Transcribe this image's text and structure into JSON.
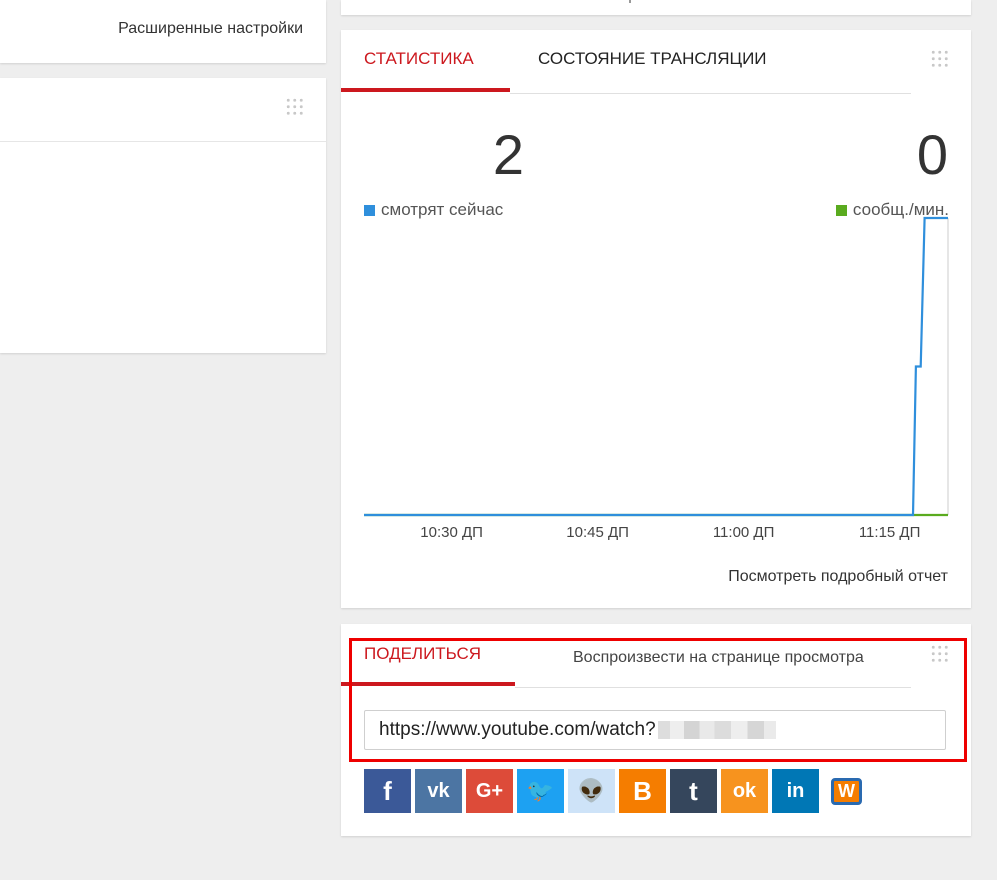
{
  "left_panel": {
    "advanced_settings_label": "Расширенные настройки"
  },
  "stats": {
    "tabs": [
      {
        "label": "СТАТИСТИКА",
        "active": true
      },
      {
        "label": "СОСТОЯНИЕ ТРАНСЛЯЦИИ",
        "active": false
      }
    ],
    "viewers_now": "2",
    "viewers_label": "смотрят сейчас",
    "messages_per_min": "0",
    "messages_label": "сообщ./мин.",
    "report_link": "Посмотреть подробный отчет",
    "colors": {
      "viewers": "#2f8fdc",
      "messages": "#5aab1f",
      "accent": "#cc181e"
    }
  },
  "chart_data": {
    "type": "line",
    "x_tick_labels": [
      "10:30 ДП",
      "10:45 ДП",
      "11:00 ДП",
      "11:15 ДП"
    ],
    "x_ticks_minutes": [
      630,
      645,
      660,
      675
    ],
    "xlim_minutes": [
      621,
      681
    ],
    "ylim": [
      0,
      2
    ],
    "series": [
      {
        "name": "смотрят сейчас",
        "color": "#2f8fdc",
        "points": [
          [
            621,
            0
          ],
          [
            677.4,
            0
          ],
          [
            677.7,
            1
          ],
          [
            678.2,
            1
          ],
          [
            678.6,
            2
          ],
          [
            681,
            2
          ]
        ]
      },
      {
        "name": "сообщ./мин.",
        "color": "#5aab1f",
        "points": [
          [
            621,
            0
          ],
          [
            681,
            0
          ]
        ]
      }
    ],
    "grid": false,
    "legend": "top"
  },
  "share": {
    "tab_share": "ПОДЕЛИТЬСЯ",
    "tab_play": "Воспроизвести на странице просмотра",
    "url_visible": "https://www.youtube.com/watch?",
    "social": [
      {
        "icon": "facebook-icon",
        "glyph": "f",
        "color": "#3b5998"
      },
      {
        "icon": "vk-icon",
        "glyph": "vk",
        "color": "#4c75a3"
      },
      {
        "icon": "google-plus-icon",
        "glyph": "G+",
        "color": "#dd4b39"
      },
      {
        "icon": "twitter-icon",
        "glyph": "🐦",
        "color": "#1da1f2"
      },
      {
        "icon": "reddit-icon",
        "glyph": "👽",
        "color": "#cee3f8"
      },
      {
        "icon": "blogger-icon",
        "glyph": "B",
        "color": "#f57d00"
      },
      {
        "icon": "tumblr-icon",
        "glyph": "t",
        "color": "#35465c"
      },
      {
        "icon": "odnoklassniki-icon",
        "glyph": "ok",
        "color": "#f7931e"
      },
      {
        "icon": "linkedin-icon",
        "glyph": "in",
        "color": "#0077b5"
      },
      {
        "icon": "mail-ru-icon",
        "glyph": "W",
        "color": "#ffffff"
      }
    ]
  }
}
